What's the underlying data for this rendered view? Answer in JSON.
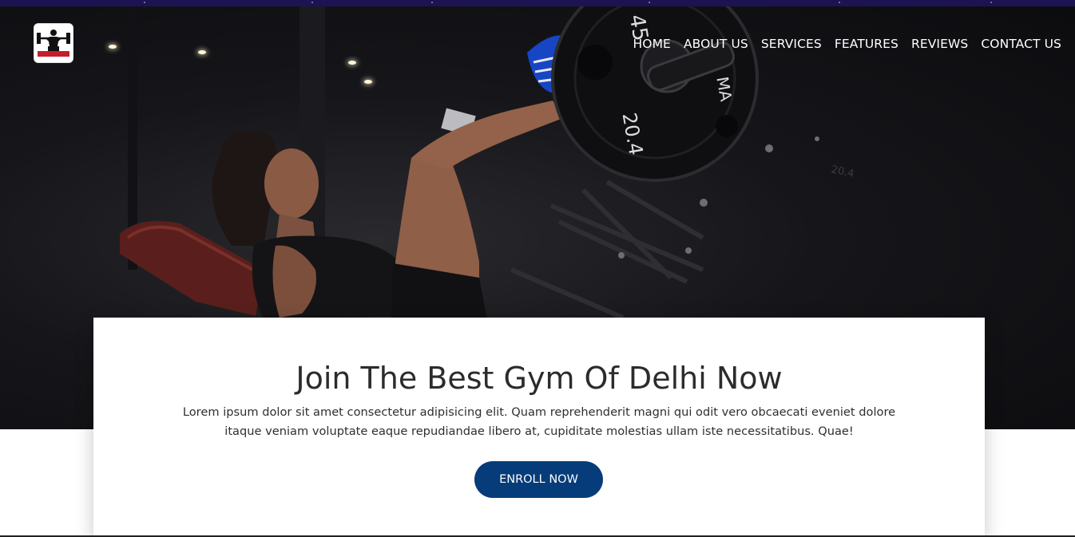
{
  "brand": {
    "logo_icon": "weightlifter-logo-icon"
  },
  "nav": {
    "items": [
      {
        "label": "HOME"
      },
      {
        "label": "ABOUT US"
      },
      {
        "label": "SERVICES"
      },
      {
        "label": "FEATURES"
      },
      {
        "label": "REVIEWS"
      },
      {
        "label": "CONTACT US"
      }
    ]
  },
  "hero": {
    "plate_weight": "45",
    "plate_number": "20.4",
    "plate_brand": "MA",
    "rack_marking": "20.4"
  },
  "card": {
    "heading": "Join The Best Gym Of Delhi Now",
    "text": "Lorem ipsum dolor sit amet consectetur adipisicing elit. Quam reprehenderit magni qui odit vero obcaecati eveniet dolore itaque veniam voluptate eaque repudiandae libero at, cupiditate molestias ullam iste necessitatibus. Quae!",
    "button_label": "ENROLL NOW"
  },
  "colors": {
    "top_strip": "#1c1352",
    "hero_bg": "#16161a",
    "button_bg": "#063c79",
    "heading_text": "#2c2c2e",
    "logo_accent": "#c41e2a"
  }
}
